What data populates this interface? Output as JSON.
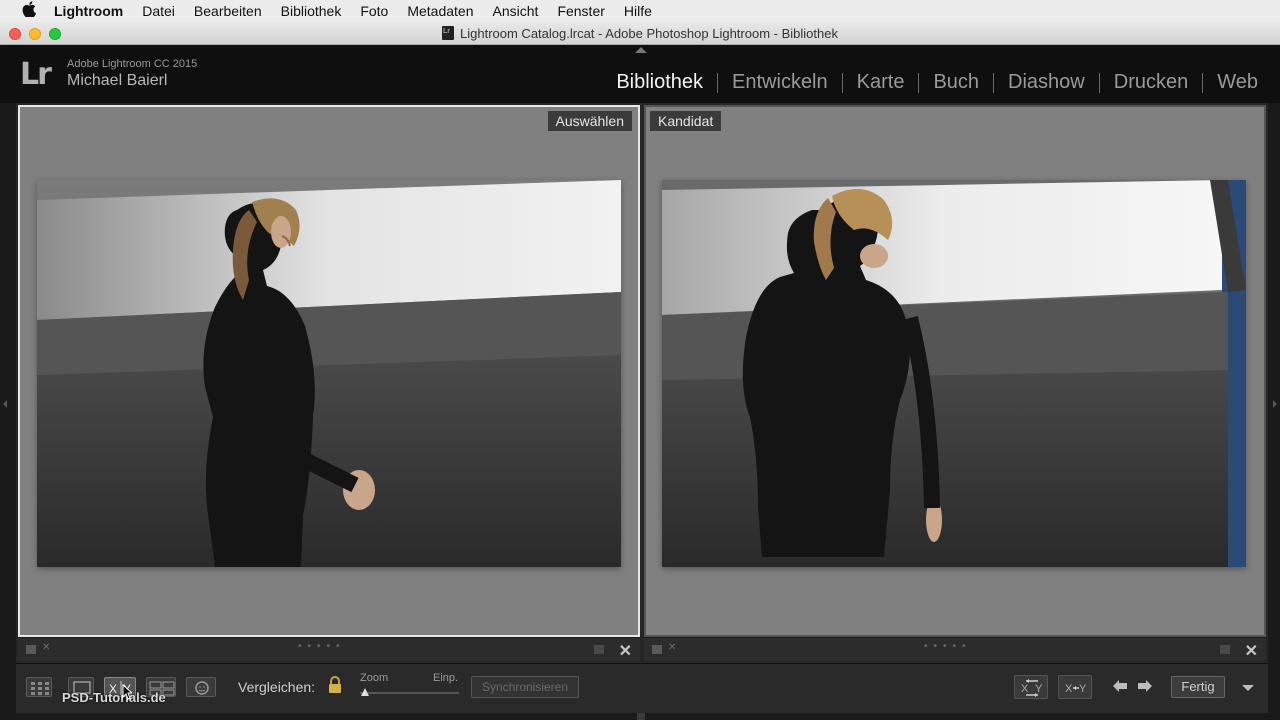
{
  "menubar": {
    "apple_icon": "apple-logo-icon",
    "items": [
      {
        "label": "Lightroom",
        "app": true
      },
      {
        "label": "Datei"
      },
      {
        "label": "Bearbeiten"
      },
      {
        "label": "Bibliothek"
      },
      {
        "label": "Foto"
      },
      {
        "label": "Metadaten"
      },
      {
        "label": "Ansicht"
      },
      {
        "label": "Fenster"
      },
      {
        "label": "Hilfe"
      }
    ]
  },
  "window": {
    "title": "Lightroom Catalog.lrcat - Adobe Photoshop Lightroom - Bibliothek"
  },
  "header": {
    "logo": "Lr",
    "version": "Adobe Lightroom CC 2015",
    "user": "Michael Baierl",
    "modules": [
      "Bibliothek",
      "Entwickeln",
      "Karte",
      "Buch",
      "Diashow",
      "Drucken",
      "Web"
    ],
    "active_module": "Bibliothek"
  },
  "compare": {
    "select_label": "Auswählen",
    "candidate_label": "Kandidat"
  },
  "toolbar": {
    "compare_label": "Vergleichen:",
    "zoom_label": "Zoom",
    "fit_label": "Einp.",
    "sync_label": "Synchronisieren",
    "done_label": "Fertig",
    "watermark": "PSD-Tutorials.de"
  },
  "colors": {
    "pane_bg": "#808080",
    "active_border": "#e8e8e8",
    "header_bg": "#0f0f0f"
  }
}
